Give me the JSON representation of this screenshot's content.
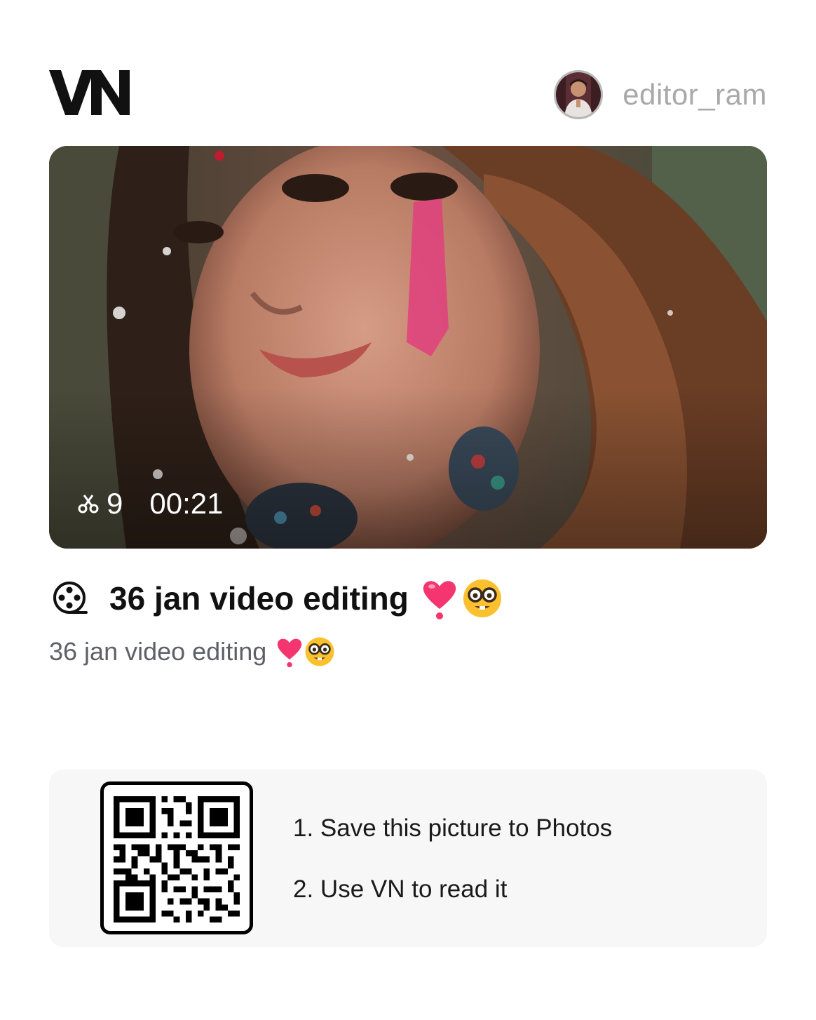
{
  "app": {
    "logo_text": "VN"
  },
  "user": {
    "username": "editor_ram",
    "avatar_icon": "user-avatar"
  },
  "video": {
    "clip_count": "9",
    "duration": "00:21",
    "title": "36 jan video editing",
    "description": "36 jan video editing",
    "title_emojis": [
      "heart-exclamation-emoji",
      "nerd-face-emoji"
    ]
  },
  "qr": {
    "step_1": "1. Save this picture to Photos",
    "step_2": "2. Use VN to read it"
  },
  "icons": {
    "cut": "scissors-icon",
    "film": "film-reel-icon"
  },
  "colors": {
    "heart": "#f5356f",
    "username": "#a9a9a9",
    "panel": "#f7f7f7"
  }
}
